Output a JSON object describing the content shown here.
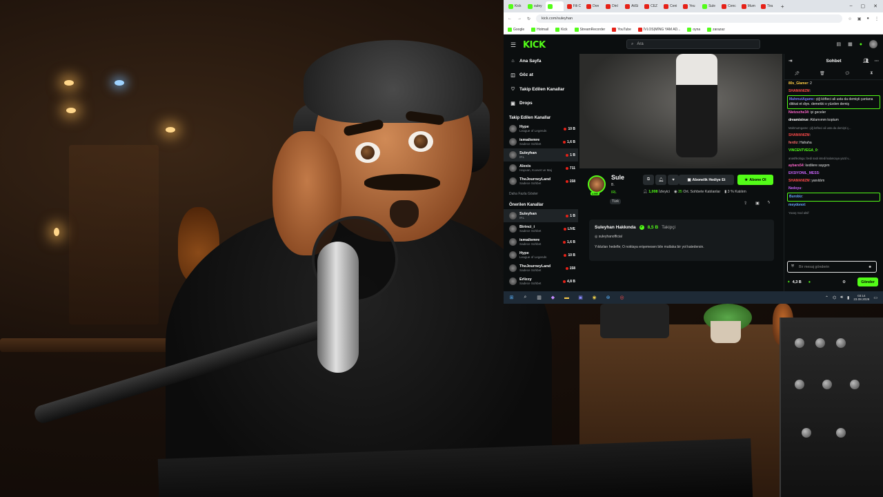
{
  "browser": {
    "tabs": [
      "Kick",
      "suley",
      "",
      "Fili C",
      "Don",
      "Dinl",
      "AtiSi",
      "CEZ",
      "Ceni",
      "Yeu",
      "Sule",
      "Cenc",
      "Mum",
      "Tira"
    ],
    "url": "kick.com/suleyhan",
    "bookmarks": [
      "Google",
      "Hotmail",
      "Kick",
      "StreamRecorder",
      "YouTube",
      "İVLOS(MİNG YAM AD...",
      "oyna",
      "zarazaz"
    ]
  },
  "kick": {
    "logo": "KICK",
    "search_placeholder": "Ara",
    "nav": [
      {
        "label": "Ana Sayfa",
        "icon": "home-icon",
        "glyph": "⌂"
      },
      {
        "label": "Göz at",
        "icon": "browse-icon",
        "glyph": "◫"
      },
      {
        "label": "Takip Edilen Kanallar",
        "icon": "heart-icon",
        "glyph": "♡"
      },
      {
        "label": "Drops",
        "icon": "drops-icon",
        "glyph": "▣"
      }
    ],
    "followed_title": "Takip Edilen Kanallar",
    "followed": [
      {
        "name": "Hype",
        "category": "League of Legends",
        "viewers": "10 B"
      },
      {
        "name": "ismailemre",
        "category": "Sadece Sohbet",
        "viewers": "1,6 B"
      },
      {
        "name": "Suleyhan",
        "category": "IRL",
        "viewers": "1 B"
      },
      {
        "name": "Alexis",
        "category": "Hayvan, Kuvvet ve Maj",
        "viewers": "711"
      },
      {
        "name": "TheJourneyLand",
        "category": "Sadece Sohbet",
        "viewers": "158"
      }
    ],
    "more_label": "Daha Fazla Göster",
    "recommended_title": "Önerilen Kanallar",
    "recommended": [
      {
        "name": "Suleyhan",
        "category": "IRL",
        "viewers": "1 B"
      },
      {
        "name": "Birinci_i",
        "category": "Sadece Sohbet",
        "viewers": "LIVE"
      },
      {
        "name": "ismailemre",
        "category": "Sadece Sohbet",
        "viewers": "1,6 B"
      },
      {
        "name": "Hype",
        "category": "League of Legends",
        "viewers": "10 B"
      },
      {
        "name": "TheJourneyLand",
        "category": "Sadece Sohbet",
        "viewers": "158"
      },
      {
        "name": "Erlizzy",
        "category": "Sadece Sohbet",
        "viewers": "4,8 B"
      }
    ],
    "streamer": {
      "name": "Sule",
      "sub": "B.",
      "category": "IRL",
      "tag": "Türk",
      "gift_label": "Abonelik Hediye Et",
      "subscribe_label": "Abone Ol",
      "viewers": "1,008",
      "viewers_label": "İzleyici",
      "chatters": "35",
      "chatters_label": "Ort. Sohbete Katılanlar",
      "participation": "3 %",
      "participation_label": "Katılım"
    },
    "about": {
      "title": "Suleyhan Hakkında",
      "followers": "8,5 B",
      "followers_label": "Takipçi",
      "instagram": "suleyhanofficial",
      "bio": "Yıldızları hedefle; O noktaya erişemesen bile mutlaka bir yol katedersin."
    },
    "chat": {
      "title": "Sohbet",
      "messages": [
        {
          "user": "80s_Glamer",
          "text": "2",
          "color": "#ffcc44",
          "style": ""
        },
        {
          "user": "SHAMANIZM",
          "text": "",
          "color": "#ff4b4b",
          "style": ""
        },
        {
          "user": "MahmutAgamc",
          "text": "çiğ köfteci ali usta da demişti çantana dikkat et diye. demekki o yüzden demiş",
          "color": "#7a7aff",
          "style": "hl"
        },
        {
          "user": "Nietzsche34",
          "text": "iyi geceler",
          "color": "#ff66cc",
          "style": ""
        },
        {
          "user": "dreamistrue",
          "text": "Ablamımm koptum",
          "color": "#ffffff",
          "style": ""
        },
        {
          "user": "",
          "text": "MahmutAgamc: çiğ köfteci ali usta da demişti ç...",
          "color": "#8a8f93",
          "style": "dim"
        },
        {
          "user": "SHAMANIZM",
          "text": "",
          "color": "#ff4b4b",
          "style": ""
        },
        {
          "user": "ferdiz",
          "text": "Hahaha",
          "color": "#ff6b6b",
          "style": ""
        },
        {
          "user": "VINCENTVEGA_0",
          "text": "",
          "color": "#53fc18",
          "style": ""
        },
        {
          "user": "",
          "text": "anashkologu: bedi sadı istedi kalancaya yazd v...",
          "color": "#8a8f93",
          "style": "dim"
        },
        {
          "user": "aybars54",
          "text": "kedilere saygım",
          "color": "#ff66cc",
          "style": ""
        },
        {
          "user": "EKSIYONIL_MESS",
          "text": "",
          "color": "#cc66ff",
          "style": ""
        },
        {
          "user": "SHAMANIZM",
          "text": "yanıldım",
          "color": "#ff4b4b",
          "style": ""
        },
        {
          "user": "Nedoyu",
          "text": "",
          "color": "#cc66ff",
          "style": ""
        },
        {
          "user": "Burobiz",
          "text": "",
          "color": "#66aaff",
          "style": "hl"
        },
        {
          "user": "meydonot",
          "text": "",
          "color": "#66aaff",
          "style": ""
        },
        {
          "user": "",
          "text": "Yavaş mod aktif",
          "color": "#8a8f93",
          "style": "dim"
        }
      ],
      "input_placeholder": "Bir mesaj gönderin",
      "points": "4,3 B",
      "send_label": "Gönder"
    }
  },
  "taskbar": {
    "time": "03:14",
    "date": "23.08.2026"
  },
  "colors": {
    "kick_green": "#53fc18",
    "kick_bg": "#0b0e0f"
  }
}
